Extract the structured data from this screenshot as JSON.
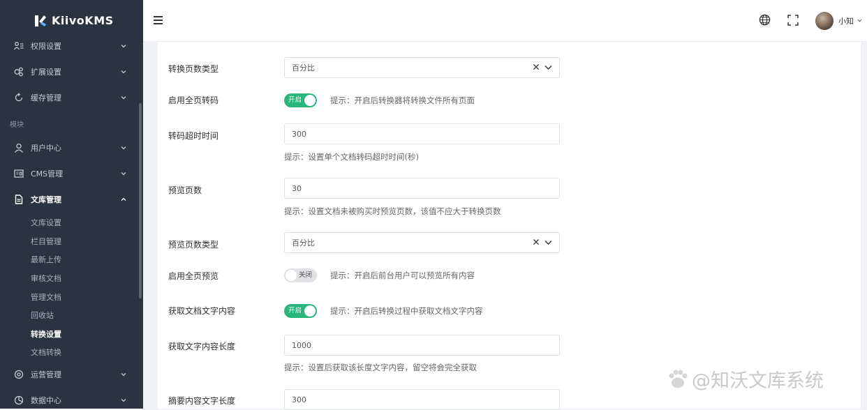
{
  "brand": {
    "name": "KiivoKMS",
    "accent": "#2ab57d",
    "sidebar_bg": "#2b3242"
  },
  "sidebar": {
    "menu": [
      {
        "label": "权限设置",
        "icon": "users-settings-icon"
      },
      {
        "label": "扩展设置",
        "icon": "extension-icon"
      },
      {
        "label": "缓存管理",
        "icon": "refresh-icon"
      }
    ],
    "section": "模块",
    "modules": [
      {
        "label": "用户中心",
        "icon": "user-icon"
      },
      {
        "label": "CMS管理",
        "icon": "cms-icon"
      },
      {
        "label": "文库管理",
        "icon": "document-icon"
      }
    ],
    "sub_items": [
      "文库设置",
      "栏目管理",
      "最新上传",
      "审核文档",
      "管理文档",
      "回收站",
      "转换设置",
      "文档转换"
    ],
    "bottom": [
      {
        "label": "运营管理",
        "icon": "operation-icon"
      },
      {
        "label": "数据中心",
        "icon": "data-icon"
      }
    ]
  },
  "header": {
    "user": "小知",
    "icons": [
      "hamburger-icon",
      "globe-icon",
      "fullscreen-icon",
      "avatar"
    ]
  },
  "form": {
    "convert_pages_type": {
      "label": "转换页数类型",
      "value": "百分比"
    },
    "full_convert": {
      "label": "启用全页转码",
      "state": "开启",
      "hint": "提示：开启后转换器将转换文件所有页面"
    },
    "convert_timeout": {
      "label": "转码超时时间",
      "value": "300",
      "hint": "提示：设置单个文档转码超时时间(秒)"
    },
    "preview_pages": {
      "label": "预览页数",
      "value": "30",
      "hint": "提示：设置文档未被购买时预览页数，该值不应大于转换页数"
    },
    "preview_pages_type": {
      "label": "预览页数类型",
      "value": "百分比"
    },
    "full_preview": {
      "label": "启用全页预览",
      "state": "关闭",
      "hint": "提示：开启后前台用户可以预览所有内容"
    },
    "fetch_text": {
      "label": "获取文档文字内容",
      "state": "开启",
      "hint": "提示：开启后转换过程中获取文档文字内容"
    },
    "text_length": {
      "label": "获取文字内容长度",
      "value": "1000",
      "hint": "提示：设置后获取该长度文字内容，留空将会完全获取"
    },
    "summary_length": {
      "label": "摘要内容文字长度",
      "value": "300"
    }
  },
  "watermark": {
    "text": "@知沃文库系统"
  }
}
